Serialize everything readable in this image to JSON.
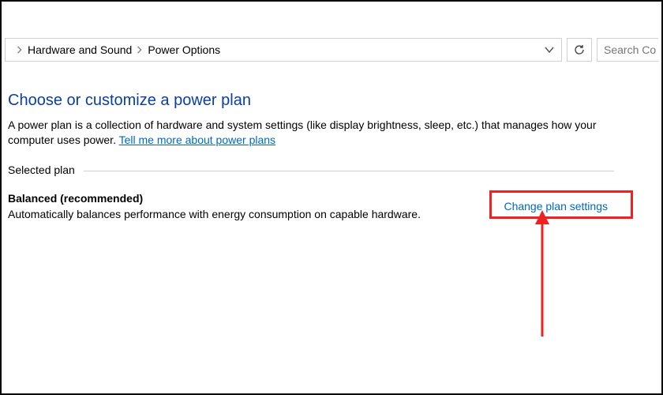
{
  "breadcrumb": {
    "item1": "Hardware and Sound",
    "item2": "Power Options"
  },
  "search": {
    "placeholder": "Search Co"
  },
  "page": {
    "title": "Choose or customize a power plan",
    "description_a": "A power plan is a collection of hardware and system settings (like display brightness, sleep, etc.) that manages how your computer uses power. ",
    "help_link": "Tell me more about power plans",
    "group_legend": "Selected plan",
    "plan_name": "Balanced (recommended)",
    "plan_desc": "Automatically balances performance with energy consumption on capable hardware.",
    "change_link": "Change plan settings"
  }
}
